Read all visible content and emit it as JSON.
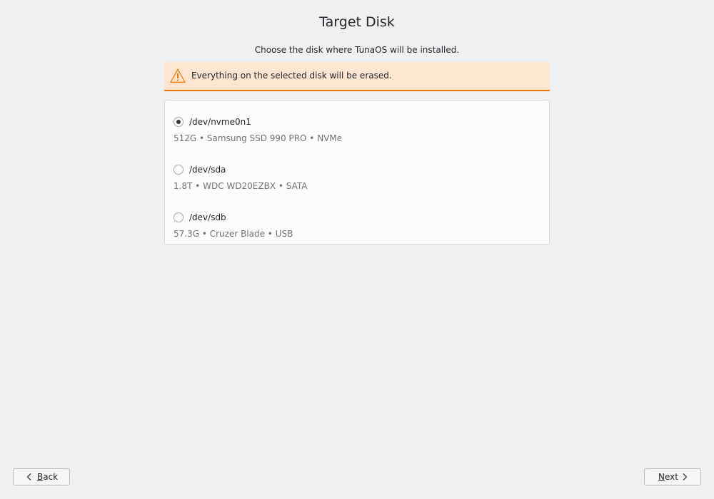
{
  "header": {
    "title": "Target Disk",
    "subtitle": "Choose the disk where TunaOS will be installed."
  },
  "warning": {
    "icon": "warning-icon",
    "text": "Everything on the selected disk will be erased.",
    "accent_color": "#f67400",
    "background_color": "#fde5d0"
  },
  "disks": [
    {
      "device": "/dev/nvme0n1",
      "details": "512G • Samsung SSD 990 PRO • NVMe",
      "selected": true
    },
    {
      "device": "/dev/sda",
      "details": "1.8T • WDC WD20EZBX • SATA",
      "selected": false
    },
    {
      "device": "/dev/sdb",
      "details": "57.3G • Cruzer Blade • USB",
      "selected": false
    }
  ],
  "footer": {
    "back": {
      "mnemonic": "B",
      "rest": "ack",
      "icon": "chevron-left-icon"
    },
    "next": {
      "mnemonic": "N",
      "rest": "ext",
      "icon": "chevron-right-icon"
    }
  }
}
